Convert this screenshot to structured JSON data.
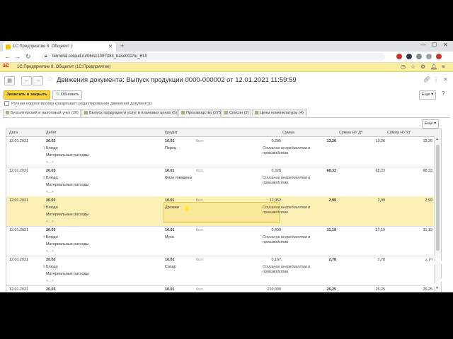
{
  "browser": {
    "tab_title": "1С:Предприятие 8. Общепит (",
    "url": "terminal.scloud.ru/06/sc1007333_base002/ru_RU/"
  },
  "app": {
    "logo": "1С",
    "title": "1С:Предприятие 8. Общепит  (1С:Предприятие)"
  },
  "document": {
    "title": "Движения документа: Выпуск продукции 0000-000002 от 12.01.2021 11:59:59"
  },
  "toolbar": {
    "save_close": "Записать и закрыть",
    "refresh": "Обновить",
    "more": "Еще"
  },
  "manual_edit_label": "Ручная корректировка (разрешает редактирование движений документа)",
  "register_tabs": [
    "Бухгалтерский и налоговый учет (20)",
    "Выпуск продукции и услуг в плановых ценах (5)",
    "Производство (275)",
    "Списан (2)",
    "Цены номенклатуры (4)"
  ],
  "table": {
    "more": "Еще",
    "columns": [
      "Дата",
      "Дебет",
      "Кредит",
      "Сумма",
      "Сумма НУ Дт",
      "Сумма НУ Кт"
    ],
    "rows": [
      {
        "date": "12.01.2021",
        "n": "1",
        "debit_acc": "20.03",
        "debit_sub1": "Блюдо",
        "debit_sub2": "Материальные расходы",
        "debit_sub3": "<...>",
        "credit_acc": "10.01",
        "credit_item": "Перец",
        "qty_label": "Кол.",
        "qty": "0,285",
        "sum": "13,26",
        "note": "Списание ингредиентов в производство",
        "nu_dt": "13,26",
        "nu_kt": "13,26"
      },
      {
        "date": "12.01.2021",
        "n": "2",
        "debit_acc": "20.03",
        "debit_sub1": "Блюдо",
        "debit_sub2": "Материальные расходы",
        "debit_sub3": "<...>",
        "credit_acc": "10.01",
        "credit_item": "Филе говядины",
        "qty_label": "Кол.",
        "qty": "0,328",
        "sum": "68,33",
        "note": "Списание ингредиентов в производство",
        "nu_dt": "68,33",
        "nu_kt": "68,33"
      },
      {
        "date": "12.01.2021",
        "n": "3",
        "debit_acc": "20.03",
        "debit_sub1": "Блюдо",
        "debit_sub2": "Материальные расходы",
        "debit_sub3": "<...>",
        "credit_acc": "10.01",
        "credit_item": "Дрожжи",
        "qty_label": "Кол.",
        "qty": "11,952",
        "sum": "2,99",
        "note": "Списание ингредиентов в производство",
        "nu_dt": "2,99",
        "nu_kt": "2,99"
      },
      {
        "date": "12.01.2021",
        "n": "4",
        "debit_acc": "20.03",
        "debit_sub1": "Блюдо",
        "debit_sub2": "Материальные расходы",
        "debit_sub3": "<...>",
        "credit_acc": "10.01",
        "credit_item": "Мука",
        "qty_label": "Кол.",
        "qty": "0,499",
        "sum": "31,19",
        "note": "Списание ингредиентов в производство",
        "nu_dt": "31,19",
        "nu_kt": "31,19"
      },
      {
        "date": "12.01.2021",
        "n": "5",
        "debit_acc": "20.03",
        "debit_sub1": "Блюдо",
        "debit_sub2": "Материальные расходы",
        "debit_sub3": "<...>",
        "credit_acc": "10.01",
        "credit_item": "Сахар",
        "qty_label": "Кол.",
        "qty": "0,167",
        "sum": "2,78",
        "note": "Списание ингредиентов в производство",
        "nu_dt": "2,78",
        "nu_kt": "2,78"
      },
      {
        "date": "12.01.2021",
        "n": "",
        "debit_acc": "20.03",
        "debit_sub1": "",
        "debit_sub2": "",
        "debit_sub3": "",
        "credit_acc": "10.01",
        "credit_item": "",
        "qty_label": "Кол.",
        "qty": "210,000",
        "sum": "26,25",
        "note": "",
        "nu_dt": "26,25",
        "nu_kt": "26,25"
      }
    ]
  },
  "colors": {
    "app_header_bg": "#fbed9e",
    "primary_button": "#fad43b",
    "selected_row": "#fbf1b7"
  }
}
